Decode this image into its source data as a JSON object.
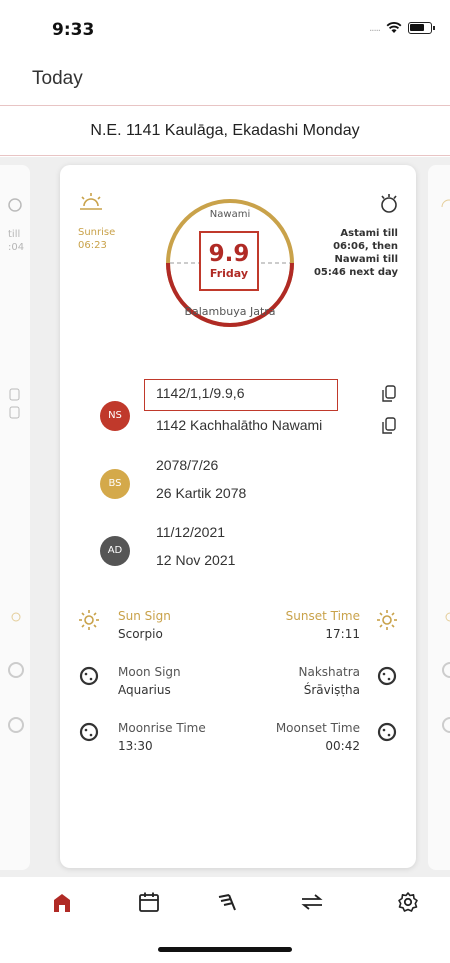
{
  "status_bar": {
    "time": "9:33",
    "signal_dots": "....."
  },
  "header": {
    "title": "Today"
  },
  "date_banner": {
    "text": "N.E. 1141 Kaulāga, Ekadashi Monday"
  },
  "left_peek": {
    "line1": "till",
    "line2": ":04"
  },
  "card": {
    "sunrise": {
      "label": "Sunrise",
      "time": "06:23"
    },
    "tithi_info": "Astami till\n06:06, then\nNawami till\n05:46 next day",
    "dial": {
      "paksha": "Nawami",
      "date_number": "9.9",
      "weekday": "Friday",
      "event": "Balambuya Jatra",
      "progress_fraction": 0.5
    },
    "calendars": [
      {
        "badge": "NS",
        "color": "#c0392b",
        "line1": "1142/1,1/9.9,6",
        "line2": "1142 Kachhalātho Nawami"
      },
      {
        "badge": "BS",
        "color": "#d4a94a",
        "line1": "2078/7/26",
        "line2": "26 Kartik 2078"
      },
      {
        "badge": "AD",
        "color": "#555555",
        "line1": "11/12/2021",
        "line2": "12 Nov 2021"
      }
    ],
    "astro": {
      "sun_sign": {
        "label": "Sun Sign",
        "value": "Scorpio"
      },
      "sunset": {
        "label": "Sunset Time",
        "value": "17:11"
      },
      "moon_sign": {
        "label": "Moon Sign",
        "value": "Aquarius"
      },
      "nakshatra": {
        "label": "Nakshatra",
        "value": "Śrāviṣṭha"
      },
      "moonrise": {
        "label": "Moonrise Time",
        "value": "13:30"
      },
      "moonset": {
        "label": "Moonset Time",
        "value": "00:42"
      }
    }
  },
  "tabs": [
    {
      "name": "home-icon",
      "active": true
    },
    {
      "name": "calendar-icon",
      "active": false
    },
    {
      "name": "mountain-icon",
      "active": false
    },
    {
      "name": "convert-icon",
      "active": false
    },
    {
      "name": "settings-icon",
      "active": false
    }
  ],
  "colors": {
    "accent": "#b02a25",
    "gold": "#c9a24a",
    "divider": "#e8c4c4"
  }
}
